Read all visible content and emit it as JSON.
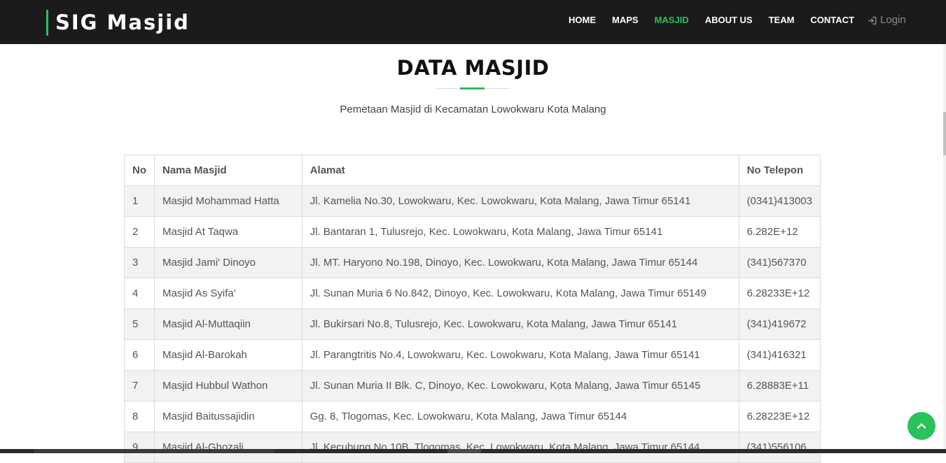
{
  "brand": "SIG Masjid",
  "nav": {
    "items": [
      "HOME",
      "MAPS",
      "MASJID",
      "ABOUT US",
      "TEAM",
      "CONTACT"
    ],
    "active": "MASJID",
    "login": "Login"
  },
  "heading": "DATA MASJID",
  "subtitle": "Pemetaan Masjid di Kecamatan Lowokwaru Kota Malang",
  "table": {
    "headers": [
      "No",
      "Nama Masjid",
      "Alamat",
      "No Telepon"
    ],
    "rows": [
      [
        "1",
        "Masjid Mohammad Hatta",
        "Jl. Kamelia No.30, Lowokwaru, Kec. Lowokwaru, Kota Malang, Jawa Timur 65141",
        "(0341)413003"
      ],
      [
        "2",
        "Masjid At Taqwa",
        "Jl. Bantaran 1, Tulusrejo, Kec. Lowokwaru, Kota Malang, Jawa Timur 65141",
        "6.282E+12"
      ],
      [
        "3",
        "Masjid Jami' Dinoyo",
        "Jl. MT. Haryono No.198, Dinoyo, Kec. Lowokwaru, Kota Malang, Jawa Timur 65144",
        "(341)567370"
      ],
      [
        "4",
        "Masjid As Syifa'",
        "Jl. Sunan Muria 6 No.842, Dinoyo, Kec. Lowokwaru, Kota Malang, Jawa Timur 65149",
        "6.28233E+12"
      ],
      [
        "5",
        "Masjid Al-Muttaqiin",
        "Jl. Bukirsari No.8, Tulusrejo, Kec. Lowokwaru, Kota Malang, Jawa Timur 65141",
        "(341)419672"
      ],
      [
        "6",
        "Masjid Al-Barokah",
        "Jl. Parangtritis No.4, Lowokwaru, Kec. Lowokwaru, Kota Malang, Jawa Timur 65141",
        "(341)416321"
      ],
      [
        "7",
        "Masjid Hubbul Wathon",
        "Jl. Sunan Muria II Blk. C, Dinoyo, Kec. Lowokwaru, Kota Malang, Jawa Timur 65145",
        "6.28883E+11"
      ],
      [
        "8",
        "Masjid Baitussajidin",
        "Gg. 8, Tlogomas, Kec. Lowokwaru, Kota Malang, Jawa Timur 65144",
        "6.28223E+12"
      ],
      [
        "9",
        "Masjid Al-Ghozali",
        "Jl. Kecubung No.10B, Tlogomas, Kec. Lowokwaru, Kota Malang, Jawa Timur 65144",
        "(341)556106"
      ]
    ]
  },
  "colors": {
    "accent": "#28c25a",
    "navbar_bg": "#1b1b1b"
  },
  "icons": {
    "login": "sign-in-icon",
    "back_to_top": "chevron-up-icon"
  }
}
